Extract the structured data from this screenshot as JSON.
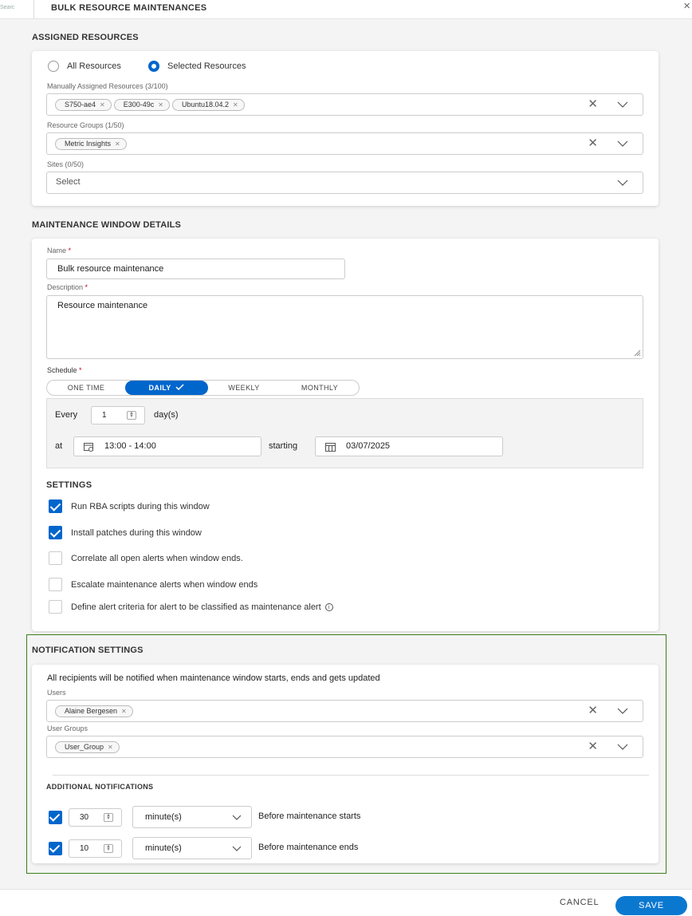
{
  "header": {
    "crumb": "Searc",
    "title": "BULK RESOURCE MAINTENANCES"
  },
  "assigned": {
    "section_title": "ASSIGNED RESOURCES",
    "radio_all": "All Resources",
    "radio_selected": "Selected Resources",
    "manual_label": "Manually Assigned Resources (3/100)",
    "manual_chips": [
      "S750-ae4",
      "E300-49c",
      "Ubuntu18.04.2"
    ],
    "groups_label": "Resource Groups (1/50)",
    "group_chips": [
      "Metric Insights"
    ],
    "sites_label": "Sites (0/50)",
    "sites_placeholder": "Select"
  },
  "window": {
    "section_title": "MAINTENANCE WINDOW DETAILS",
    "name_label": "Name",
    "name_value": "Bulk resource maintenance",
    "desc_label": "Description",
    "desc_value": "Resource maintenance",
    "schedule_label": "Schedule",
    "schedule_options": [
      "ONE TIME",
      "DAILY",
      "WEEKLY",
      "MONTHLY"
    ],
    "schedule_selected": "DAILY",
    "every_label": "Every",
    "every_value": "1",
    "every_unit": "day(s)",
    "at_label": "at",
    "time_value": "13:00 - 14:00",
    "starting_label": "starting",
    "date_value": "03/07/2025",
    "settings_title": "SETTINGS",
    "settings": [
      {
        "label": "Run RBA scripts during this window",
        "checked": true
      },
      {
        "label": "Install patches during this window",
        "checked": true
      },
      {
        "label": "Correlate all open alerts when window ends.",
        "checked": false
      },
      {
        "label": "Escalate maintenance alerts when window ends",
        "checked": false
      },
      {
        "label": "Define alert criteria for alert to be classified as maintenance alert",
        "checked": false
      }
    ]
  },
  "notification": {
    "section_title": "NOTIFICATION SETTINGS",
    "info_text": "All recipients will be notified when maintenance window starts, ends and gets updated",
    "users_label": "Users",
    "user_chips": [
      "Alaine Bergesen"
    ],
    "groups_label": "User Groups",
    "group_chips": [
      "User_Group"
    ],
    "additional_title": "ADDITIONAL NOTIFICATIONS",
    "additional": [
      {
        "value": "30",
        "unit": "minute(s)",
        "text": "Before maintenance starts",
        "checked": true
      },
      {
        "value": "10",
        "unit": "minute(s)",
        "text": "Before maintenance ends",
        "checked": true
      }
    ]
  },
  "footer": {
    "cancel": "CANCEL",
    "save": "SAVE"
  },
  "colors": {
    "accent": "#0066cc",
    "highlight_border": "#3a7d1e"
  }
}
